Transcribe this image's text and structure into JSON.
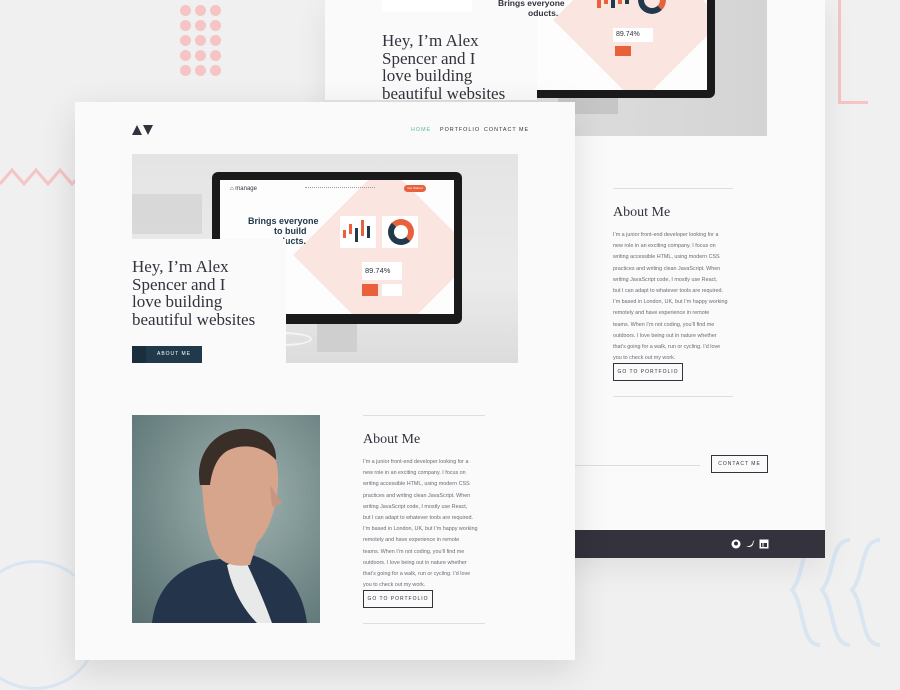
{
  "back_page": {
    "hero_title": [
      "Hey, I’m Alex",
      "Spencer and I",
      "love building",
      "beautiful websites"
    ],
    "screen_heading": [
      "Brings everyone",
      "oducts."
    ],
    "screen_percent": "89.74%",
    "about": {
      "title": "About Me",
      "paragraph": [
        "I’m a junior front-end developer looking for a",
        "new role in an exciting company. I focus on",
        "writing accessible HTML, using modern CSS",
        "practices and writing clean JavaScript. When",
        "writing JavaScript code, I mostly use React,",
        "but I can adapt to whatever tools are required.",
        "I’m based in London, UK, but I’m happy working",
        "remotely and have experience in remote",
        "teams. When I’m not coding, you’ll find me",
        "outdoors. I love being out in nature whether",
        "that’s going for a walk, run or cycling. I’d love",
        "you to check out my work."
      ],
      "button": "GO TO PORTFOLIO"
    },
    "contact_button": "CONTACT ME",
    "footer_icons": [
      "github-icon",
      "twitter-icon",
      "linkedin-icon"
    ]
  },
  "front_page": {
    "nav": {
      "home": "HOME",
      "portfolio": "PORTFOLIO",
      "contact": "CONTACT ME"
    },
    "hero_title": [
      "Hey, I’m Alex",
      "Spencer and I",
      "love building",
      "beautiful websites"
    ],
    "about_me_button": "ABOUT ME",
    "screen": {
      "brand": "manage",
      "heading": [
        "Brings everyone",
        "to build",
        "oducts."
      ],
      "percent": "89.74%",
      "cta": "Get Started"
    },
    "about": {
      "title": "About Me",
      "paragraph": [
        "I’m a junior front-end developer looking for a",
        "new role in an exciting company. I focus on",
        "writing accessible HTML, using modern CSS",
        "practices and writing clean JavaScript. When",
        "writing JavaScript code, I mostly use React,",
        "but I can adapt to whatever tools are required.",
        "I’m based in London, UK, but I’m happy working",
        "remotely and have experience in remote",
        "teams. When I’m not coding, you’ll find me",
        "outdoors. I love being out in nature whether",
        "that’s going for a walk, run or cycling. I’d love",
        "you to check out my work."
      ],
      "button": "GO TO PORTFOLIO"
    }
  },
  "colors": {
    "accent": "#5fb4a2",
    "dark": "#203a4c",
    "text": "#33323d",
    "orange": "#e8613c",
    "pink": "#f6c4c4"
  }
}
